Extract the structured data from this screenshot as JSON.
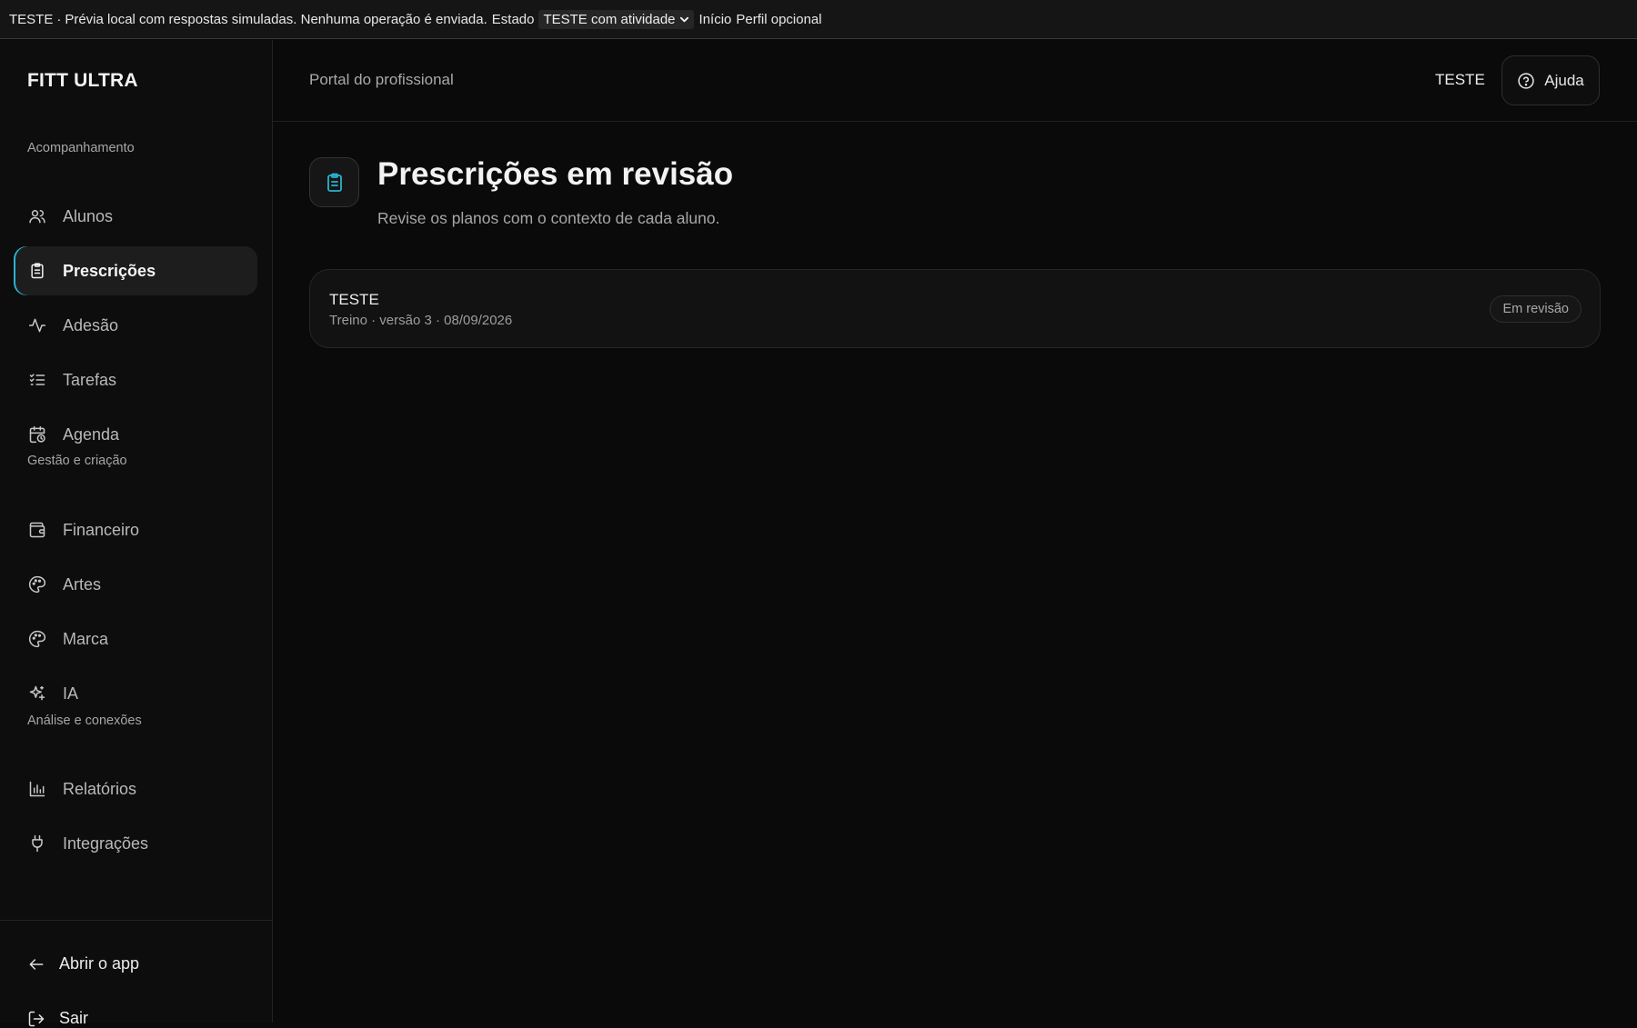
{
  "banner": {
    "prefix": "TESTE",
    "separator": "·",
    "message": "Prévia local com respostas simuladas. Nenhuma operação é enviada.",
    "state_label": "Estado",
    "state_value": "TESTE com atividade",
    "link_inicio": "Início",
    "link_perfil": "Perfil opcional"
  },
  "sidebar": {
    "brand": "FITT ULTRA",
    "sections": {
      "tracking": "Acompanhamento",
      "management": "Gestão e criação",
      "analysis": "Análise e conexões"
    },
    "items": [
      {
        "label": "Alunos",
        "icon": "users-icon"
      },
      {
        "label": "Prescrições",
        "icon": "clipboard-icon",
        "active": true
      },
      {
        "label": "Adesão",
        "icon": "activity-icon"
      },
      {
        "label": "Tarefas",
        "icon": "list-checks-icon"
      },
      {
        "label": "Agenda",
        "icon": "calendar-clock-icon"
      },
      {
        "label": "Financeiro",
        "icon": "wallet-icon"
      },
      {
        "label": "Artes",
        "icon": "palette-icon"
      },
      {
        "label": "Marca",
        "icon": "palette-icon"
      },
      {
        "label": "IA",
        "icon": "sparkles-icon"
      },
      {
        "label": "Relatórios",
        "icon": "bar-chart-icon"
      },
      {
        "label": "Integrações",
        "icon": "plug-icon"
      }
    ],
    "footer": {
      "open_app": "Abrir o app",
      "logout": "Sair"
    }
  },
  "header": {
    "portal": "Portal do profissional",
    "user": "TESTE",
    "help": "Ajuda"
  },
  "main": {
    "title": "Prescrições em revisão",
    "subtitle": "Revise os planos com o contexto de cada aluno.",
    "prescriptions": [
      {
        "name": "TESTE",
        "meta": "Treino · versão 3 · 08/09/2026",
        "status": "Em revisão"
      }
    ]
  },
  "colors": {
    "accent": "#2bb3d0",
    "background": "#0a0a0a",
    "sidebar": "#0d0d0d"
  }
}
